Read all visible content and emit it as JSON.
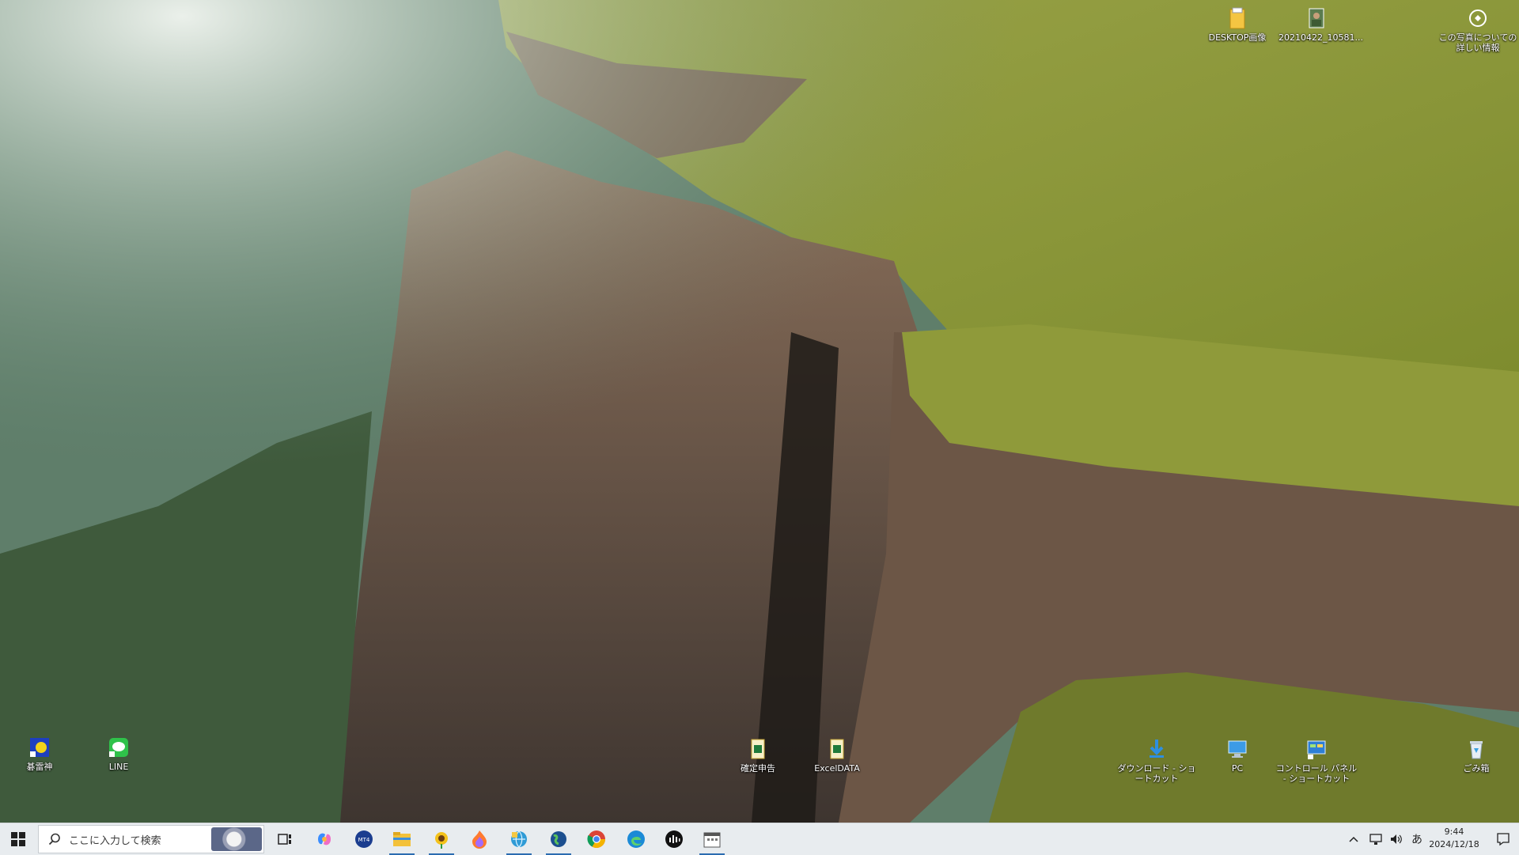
{
  "desktop": {
    "icons": {
      "desktop_images": "DESKTOP画像",
      "photo_file": "20210422_10581...",
      "photo_info": "この写真についての詳しい情報",
      "kyorai": "碁雷神",
      "line": "LINE",
      "kakutei": "確定申告",
      "exceldata": "ExcelDATA",
      "download_shortcut": "ダウンロード - ショートカット",
      "pc": "PC",
      "control_panel": "コントロール パネル - ショートカット",
      "recycle_bin": "ごみ箱"
    }
  },
  "taskbar": {
    "search_placeholder": "ここに入力して検索",
    "tray_ime": "あ",
    "tray_chevron": "^",
    "clock_time": "9:44",
    "clock_date": "2024/12/18",
    "pinned": [
      "task-view",
      "copilot",
      "mt4",
      "file-explorer",
      "sunflower-app",
      "flame-app",
      "network-app",
      "globe-app",
      "chrome",
      "edge",
      "audio-app",
      "calendar-app"
    ],
    "colors": {
      "accent": "#2b6cb0",
      "bar": "#e8ecef"
    }
  }
}
